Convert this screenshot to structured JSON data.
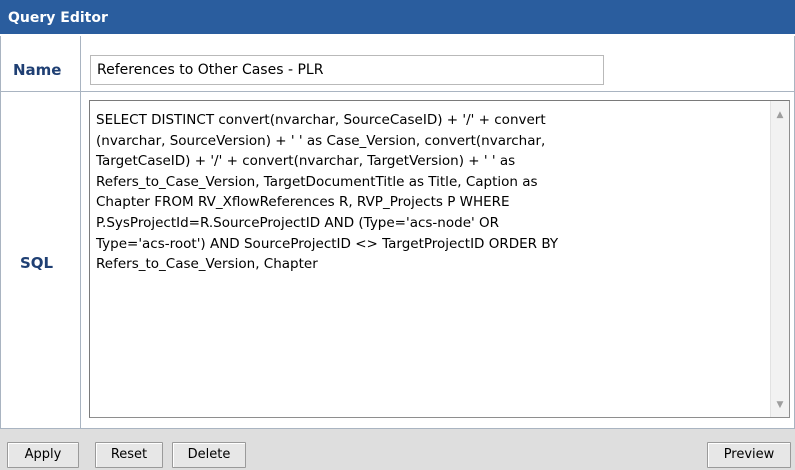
{
  "editor": {
    "title": "Query Editor",
    "name_label": "Name",
    "name_value": "References to Other Cases - PLR",
    "sql_label": "SQL",
    "sql_value": "SELECT DISTINCT convert(nvarchar, SourceCaseID) + '/' + convert\n(nvarchar, SourceVersion) + ' ' as Case_Version, convert(nvarchar,\nTargetCaseID) + '/' + convert(nvarchar, TargetVersion) + ' ' as\nRefers_to_Case_Version, TargetDocumentTitle as Title, Caption as\nChapter FROM RV_XflowReferences R, RVP_Projects P WHERE\nP.SysProjectId=R.SourceProjectID AND (Type='acs-node' OR\nType='acs-root') AND SourceProjectID <> TargetProjectID ORDER BY\nRefers_to_Case_Version, Chapter"
  },
  "buttons": {
    "apply": "Apply",
    "reset": "Reset",
    "delete": "Delete",
    "preview": "Preview"
  },
  "icons": {
    "scroll_up": "scroll-up-arrow-icon",
    "scroll_down": "scroll-down-arrow-icon"
  },
  "colors": {
    "title_bar": "#2a5d9e",
    "label": "#1f3f73",
    "footer": "#dedede"
  }
}
